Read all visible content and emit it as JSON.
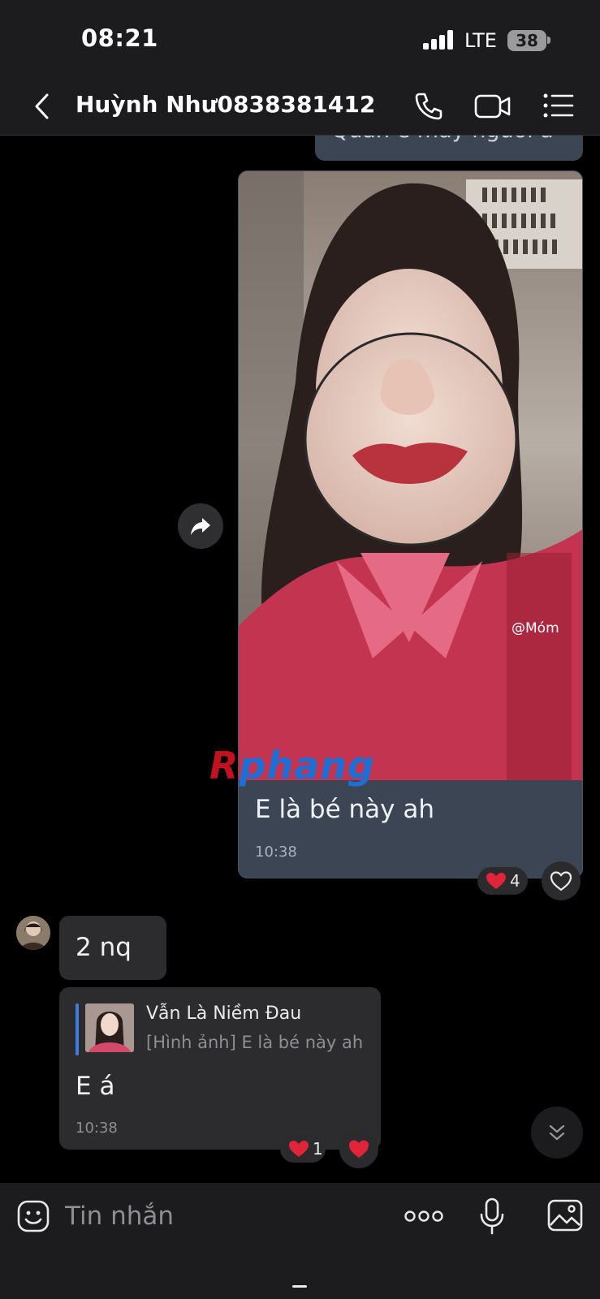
{
  "status_bar": {
    "time": "08:21",
    "network": "LTE",
    "battery": "38"
  },
  "header": {
    "contact_name": "Huỳnh Như0838381412"
  },
  "chat": {
    "previous_message_fragment": "Quản e mấy người á",
    "image_message": {
      "caption": "E là bé này ah",
      "time": "10:38",
      "reaction_count": "4",
      "tiktok_tag": "@Móm"
    },
    "watermark": {
      "part1": "R",
      "part2": "phang"
    },
    "incoming_message": {
      "text": "2 nq"
    },
    "reply_message": {
      "quoted_name": "Vẫn Là Niềm Đau",
      "quoted_text": "[Hình ảnh] E là bé này ah",
      "text": "E á",
      "time": "10:38",
      "reaction_count": "1"
    }
  },
  "composer": {
    "placeholder": "Tin nhắn"
  },
  "colors": {
    "outgoing_bubble": "#3b4553",
    "incoming_bubble": "#2c2c2e",
    "accent": "#3d7ce0",
    "heart": "#e0243a"
  }
}
